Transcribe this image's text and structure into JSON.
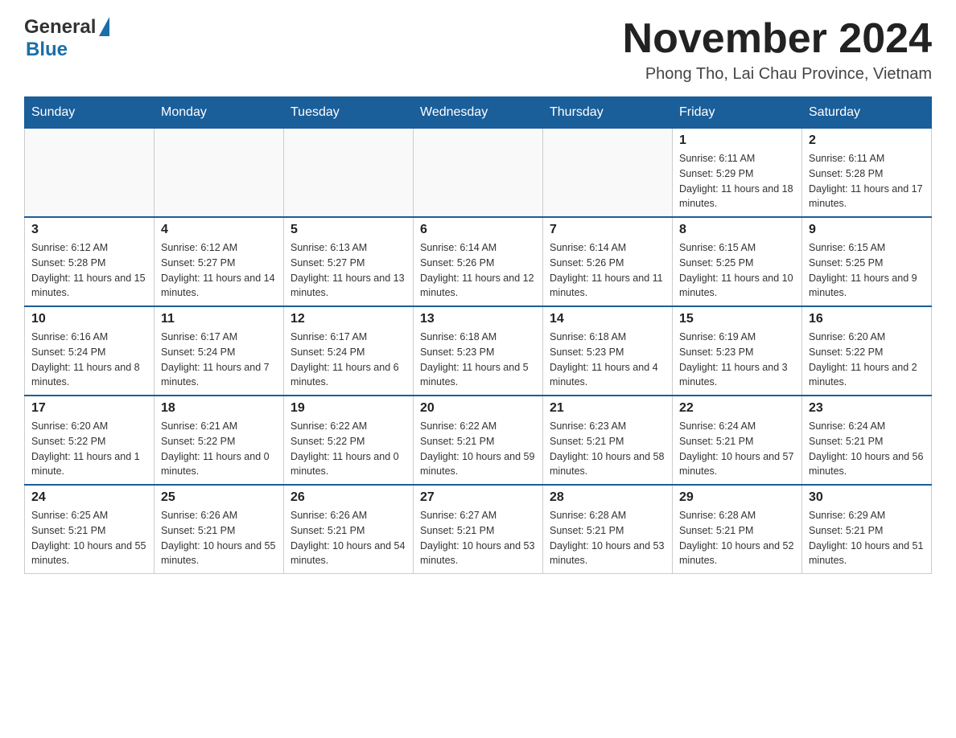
{
  "logo": {
    "general": "General",
    "blue": "Blue",
    "triangle": "▲"
  },
  "title": "November 2024",
  "location": "Phong Tho, Lai Chau Province, Vietnam",
  "days_of_week": [
    "Sunday",
    "Monday",
    "Tuesday",
    "Wednesday",
    "Thursday",
    "Friday",
    "Saturday"
  ],
  "weeks": [
    {
      "days": [
        {
          "date": "",
          "info": ""
        },
        {
          "date": "",
          "info": ""
        },
        {
          "date": "",
          "info": ""
        },
        {
          "date": "",
          "info": ""
        },
        {
          "date": "",
          "info": ""
        },
        {
          "date": "1",
          "info": "Sunrise: 6:11 AM\nSunset: 5:29 PM\nDaylight: 11 hours and 18 minutes."
        },
        {
          "date": "2",
          "info": "Sunrise: 6:11 AM\nSunset: 5:28 PM\nDaylight: 11 hours and 17 minutes."
        }
      ]
    },
    {
      "days": [
        {
          "date": "3",
          "info": "Sunrise: 6:12 AM\nSunset: 5:28 PM\nDaylight: 11 hours and 15 minutes."
        },
        {
          "date": "4",
          "info": "Sunrise: 6:12 AM\nSunset: 5:27 PM\nDaylight: 11 hours and 14 minutes."
        },
        {
          "date": "5",
          "info": "Sunrise: 6:13 AM\nSunset: 5:27 PM\nDaylight: 11 hours and 13 minutes."
        },
        {
          "date": "6",
          "info": "Sunrise: 6:14 AM\nSunset: 5:26 PM\nDaylight: 11 hours and 12 minutes."
        },
        {
          "date": "7",
          "info": "Sunrise: 6:14 AM\nSunset: 5:26 PM\nDaylight: 11 hours and 11 minutes."
        },
        {
          "date": "8",
          "info": "Sunrise: 6:15 AM\nSunset: 5:25 PM\nDaylight: 11 hours and 10 minutes."
        },
        {
          "date": "9",
          "info": "Sunrise: 6:15 AM\nSunset: 5:25 PM\nDaylight: 11 hours and 9 minutes."
        }
      ]
    },
    {
      "days": [
        {
          "date": "10",
          "info": "Sunrise: 6:16 AM\nSunset: 5:24 PM\nDaylight: 11 hours and 8 minutes."
        },
        {
          "date": "11",
          "info": "Sunrise: 6:17 AM\nSunset: 5:24 PM\nDaylight: 11 hours and 7 minutes."
        },
        {
          "date": "12",
          "info": "Sunrise: 6:17 AM\nSunset: 5:24 PM\nDaylight: 11 hours and 6 minutes."
        },
        {
          "date": "13",
          "info": "Sunrise: 6:18 AM\nSunset: 5:23 PM\nDaylight: 11 hours and 5 minutes."
        },
        {
          "date": "14",
          "info": "Sunrise: 6:18 AM\nSunset: 5:23 PM\nDaylight: 11 hours and 4 minutes."
        },
        {
          "date": "15",
          "info": "Sunrise: 6:19 AM\nSunset: 5:23 PM\nDaylight: 11 hours and 3 minutes."
        },
        {
          "date": "16",
          "info": "Sunrise: 6:20 AM\nSunset: 5:22 PM\nDaylight: 11 hours and 2 minutes."
        }
      ]
    },
    {
      "days": [
        {
          "date": "17",
          "info": "Sunrise: 6:20 AM\nSunset: 5:22 PM\nDaylight: 11 hours and 1 minute."
        },
        {
          "date": "18",
          "info": "Sunrise: 6:21 AM\nSunset: 5:22 PM\nDaylight: 11 hours and 0 minutes."
        },
        {
          "date": "19",
          "info": "Sunrise: 6:22 AM\nSunset: 5:22 PM\nDaylight: 11 hours and 0 minutes."
        },
        {
          "date": "20",
          "info": "Sunrise: 6:22 AM\nSunset: 5:21 PM\nDaylight: 10 hours and 59 minutes."
        },
        {
          "date": "21",
          "info": "Sunrise: 6:23 AM\nSunset: 5:21 PM\nDaylight: 10 hours and 58 minutes."
        },
        {
          "date": "22",
          "info": "Sunrise: 6:24 AM\nSunset: 5:21 PM\nDaylight: 10 hours and 57 minutes."
        },
        {
          "date": "23",
          "info": "Sunrise: 6:24 AM\nSunset: 5:21 PM\nDaylight: 10 hours and 56 minutes."
        }
      ]
    },
    {
      "days": [
        {
          "date": "24",
          "info": "Sunrise: 6:25 AM\nSunset: 5:21 PM\nDaylight: 10 hours and 55 minutes."
        },
        {
          "date": "25",
          "info": "Sunrise: 6:26 AM\nSunset: 5:21 PM\nDaylight: 10 hours and 55 minutes."
        },
        {
          "date": "26",
          "info": "Sunrise: 6:26 AM\nSunset: 5:21 PM\nDaylight: 10 hours and 54 minutes."
        },
        {
          "date": "27",
          "info": "Sunrise: 6:27 AM\nSunset: 5:21 PM\nDaylight: 10 hours and 53 minutes."
        },
        {
          "date": "28",
          "info": "Sunrise: 6:28 AM\nSunset: 5:21 PM\nDaylight: 10 hours and 53 minutes."
        },
        {
          "date": "29",
          "info": "Sunrise: 6:28 AM\nSunset: 5:21 PM\nDaylight: 10 hours and 52 minutes."
        },
        {
          "date": "30",
          "info": "Sunrise: 6:29 AM\nSunset: 5:21 PM\nDaylight: 10 hours and 51 minutes."
        }
      ]
    }
  ]
}
